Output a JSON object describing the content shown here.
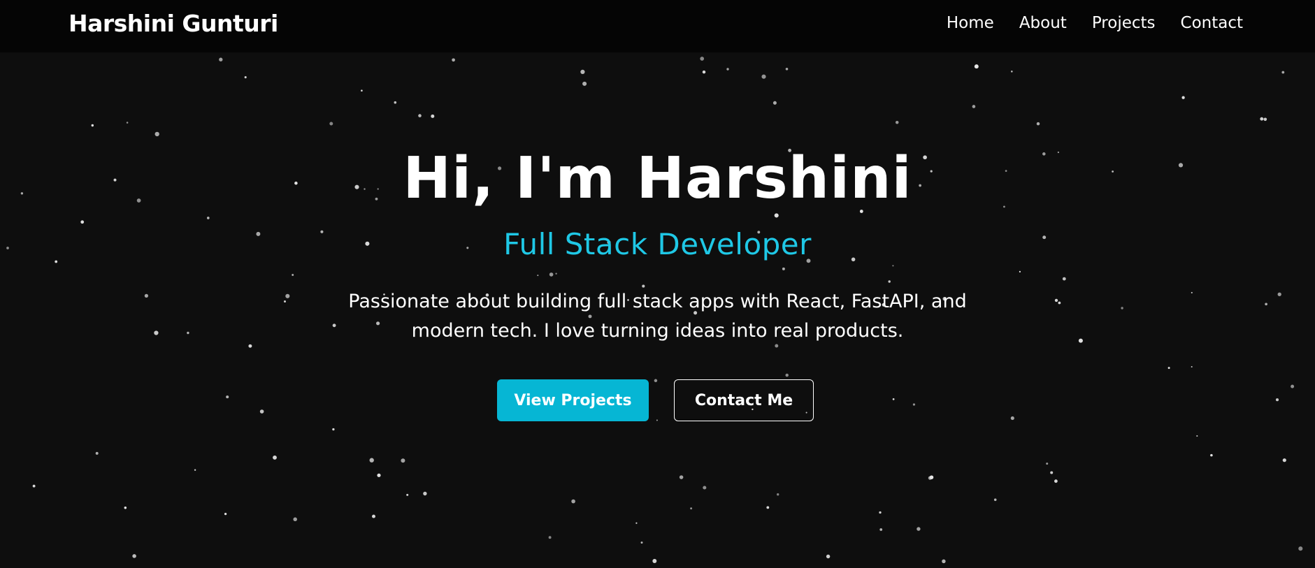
{
  "navbar": {
    "brand": "Harshini Gunturi",
    "links": [
      "Home",
      "About",
      "Projects",
      "Contact"
    ]
  },
  "hero": {
    "title": "Hi, I'm Harshini",
    "subtitle": "Full Stack Developer",
    "description": "Passionate about building full stack apps with React, FastAPI, and modern tech. I love turning ideas into real products.",
    "primary_button": "View Projects",
    "secondary_button": "Contact Me"
  },
  "colors": {
    "background": "#0e0e0e",
    "navbar": "#050505",
    "accent": "#06b6d4",
    "subtitle": "#1fc8e6",
    "text": "#ffffff"
  }
}
